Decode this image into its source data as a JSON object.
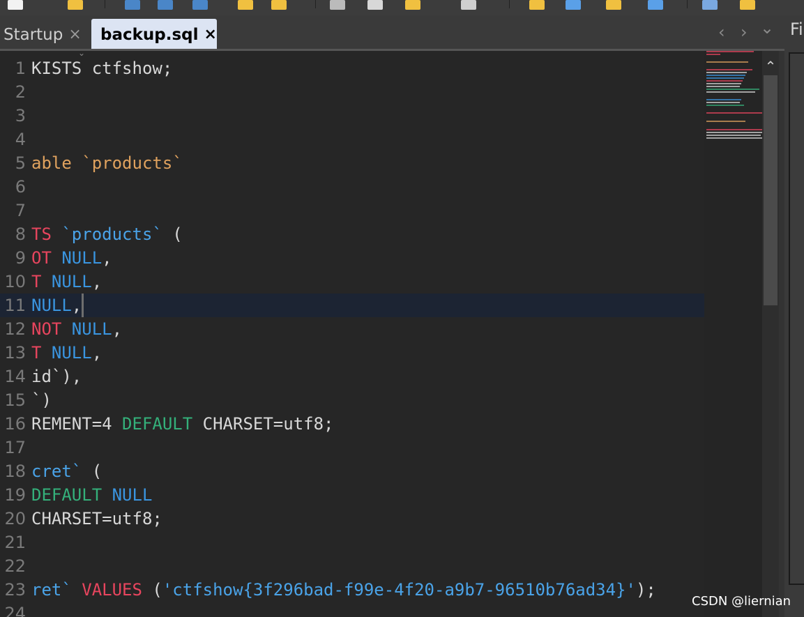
{
  "toolbar": {
    "icons": [
      "new-file-icon",
      "open-folder-icon",
      "save-icon",
      "save-as-icon",
      "save-all-icon",
      "copy-file-icon",
      "paste-icon",
      "cut-icon",
      "copy-icon",
      "paste-special-icon",
      "delete-icon",
      "find-icon",
      "font-icon",
      "highlight-icon",
      "pen-icon",
      "edit-icon",
      "comment-icon"
    ]
  },
  "tabs": [
    {
      "label": "Startup",
      "close": "×"
    },
    {
      "label": "backup.sql",
      "close": "×"
    }
  ],
  "tabnav": {
    "left": "‹",
    "right": "›",
    "down": "⌄"
  },
  "right_panel": {
    "title": "Fi"
  },
  "editor": {
    "current_line": 11,
    "lines": [
      {
        "n": "1",
        "segs": [
          {
            "t": "KISTS ctfshow;",
            "c": ""
          }
        ]
      },
      {
        "n": "2",
        "segs": []
      },
      {
        "n": "3",
        "segs": []
      },
      {
        "n": "4",
        "segs": []
      },
      {
        "n": "5",
        "segs": [
          {
            "t": "able `products`",
            "c": "str-orange"
          }
        ]
      },
      {
        "n": "6",
        "segs": []
      },
      {
        "n": "7",
        "segs": []
      },
      {
        "n": "8",
        "segs": [
          {
            "t": "TS ",
            "c": "kw-red"
          },
          {
            "t": "`products`",
            "c": "str-blue"
          },
          {
            "t": " (",
            "c": ""
          }
        ]
      },
      {
        "n": "9",
        "segs": [
          {
            "t": "OT ",
            "c": "kw-red"
          },
          {
            "t": "NULL",
            "c": "kw-blue"
          },
          {
            "t": ",",
            "c": ""
          }
        ]
      },
      {
        "n": "10",
        "segs": [
          {
            "t": "T ",
            "c": "kw-red"
          },
          {
            "t": "NULL",
            "c": "kw-blue"
          },
          {
            "t": ",",
            "c": ""
          }
        ]
      },
      {
        "n": "11",
        "segs": [
          {
            "t": "NULL",
            "c": "kw-blue"
          },
          {
            "t": ",",
            "c": ""
          }
        ]
      },
      {
        "n": "12",
        "segs": [
          {
            "t": "NOT ",
            "c": "kw-red"
          },
          {
            "t": "NULL",
            "c": "kw-blue"
          },
          {
            "t": ",",
            "c": ""
          }
        ]
      },
      {
        "n": "13",
        "segs": [
          {
            "t": "T ",
            "c": "kw-red"
          },
          {
            "t": "NULL",
            "c": "kw-blue"
          },
          {
            "t": ",",
            "c": ""
          }
        ]
      },
      {
        "n": "14",
        "segs": [
          {
            "t": "id`),",
            "c": ""
          }
        ]
      },
      {
        "n": "15",
        "segs": [
          {
            "t": "`)",
            "c": ""
          }
        ]
      },
      {
        "n": "16",
        "segs": [
          {
            "t": "REMENT=4 ",
            "c": ""
          },
          {
            "t": "DEFAULT",
            "c": "kw-green"
          },
          {
            "t": " CHARSET=utf8;",
            "c": ""
          }
        ]
      },
      {
        "n": "17",
        "segs": []
      },
      {
        "n": "18",
        "segs": [
          {
            "t": "cret`",
            "c": "str-blue"
          },
          {
            "t": " (",
            "c": ""
          }
        ]
      },
      {
        "n": "19",
        "segs": [
          {
            "t": "DEFAULT ",
            "c": "kw-green"
          },
          {
            "t": "NULL",
            "c": "kw-blue"
          }
        ]
      },
      {
        "n": "20",
        "segs": [
          {
            "t": "CHARSET=utf8;",
            "c": ""
          }
        ]
      },
      {
        "n": "21",
        "segs": []
      },
      {
        "n": "22",
        "segs": []
      },
      {
        "n": "23",
        "segs": [
          {
            "t": "ret`",
            "c": "str-blue"
          },
          {
            "t": " ",
            "c": ""
          },
          {
            "t": "VALUES",
            "c": "kw-red"
          },
          {
            "t": " (",
            "c": ""
          },
          {
            "t": "'ctfshow{3f296bad-f99e-4f20-a9b7-96510b76ad34}'",
            "c": "str-blue"
          },
          {
            "t": ");",
            "c": ""
          }
        ]
      },
      {
        "n": "24",
        "segs": []
      }
    ]
  },
  "scrollbar": {
    "up": "⌃"
  },
  "watermark": "CSDN @liernian",
  "colors": {
    "red": "#e8455e",
    "blue": "#3a95e0",
    "green": "#34b07a",
    "orange": "#e0a25e"
  }
}
